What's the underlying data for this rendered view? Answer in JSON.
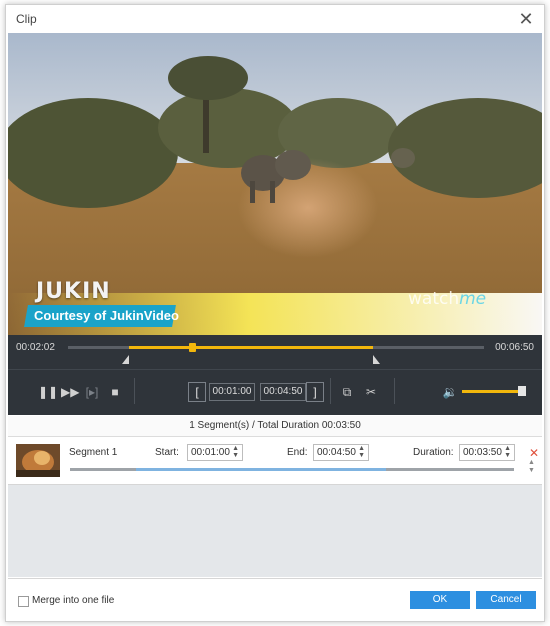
{
  "window": {
    "title": "Clip"
  },
  "video": {
    "watermark_logo": "JUKIN",
    "watermark_courtesy": "Courtesy of JukinVideo",
    "watermark_watch": "watch",
    "watermark_me": "me"
  },
  "playback": {
    "current_time": "00:02:02",
    "total_time": "00:06:50",
    "played_fraction": 0.298,
    "selection_start_fraction": 0.146,
    "selection_end_fraction": 0.732,
    "start_box": "00:01:00",
    "end_box": "00:04:50",
    "volume_fraction": 1.0
  },
  "summary": "1 Segment(s) / Total Duration 00:03:50",
  "segments": [
    {
      "name": "Segment 1",
      "start_label": "Start:",
      "start": "00:01:00",
      "end_label": "End:",
      "end": "00:04:50",
      "duration_label": "Duration:",
      "duration": "00:03:50"
    }
  ],
  "footer": {
    "merge_label": "Merge into one file",
    "merge_checked": false,
    "ok": "OK",
    "cancel": "Cancel"
  },
  "colors": {
    "accent": "#f2b70c",
    "button": "#2d8fe0",
    "controls_bg": "#2f343a"
  }
}
